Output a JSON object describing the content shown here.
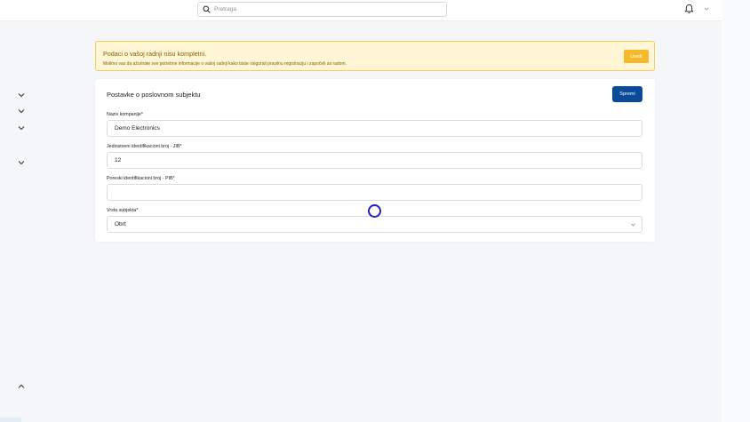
{
  "header": {
    "search_placeholder": "Pretraga",
    "icons": {
      "search": "search-icon",
      "notifications": "bell-icon",
      "user_menu": "chevron-down-icon"
    }
  },
  "sidebar": {
    "chevrons": [
      "chevron-down-icon",
      "chevron-down-icon",
      "chevron-down-icon",
      "chevron-down-icon",
      "chevron-up-icon"
    ]
  },
  "alert": {
    "title": "Podaci o vašoj radnji nisu kompletni.",
    "message": "Molimo vas da ažurirate sve potrebne informacije o vašoj radnji kako biste osigurali pravilnu registraciju i započeli sa radom.",
    "button_label": "Uredi",
    "colors": {
      "background": "#fff6d6",
      "border": "#f2cf5c",
      "text": "#8a5d00",
      "button": "#f6b92b"
    }
  },
  "form": {
    "title": "Postavke o poslovnom subjektu",
    "save_label": "Spremi",
    "save_color": "#0a4a9a",
    "fields": {
      "company_name": {
        "label": "Naziv kompanije*",
        "value": "Demo Electronics"
      },
      "jib": {
        "label": "Jedinstveni identifikacioni broj - JIB*",
        "value": "12"
      },
      "pib": {
        "label": "Poreski identifikacioni broj - PIB*",
        "value": ""
      },
      "entity_type": {
        "label": "Vrsta subjekta*",
        "value": "Obrt"
      }
    }
  }
}
